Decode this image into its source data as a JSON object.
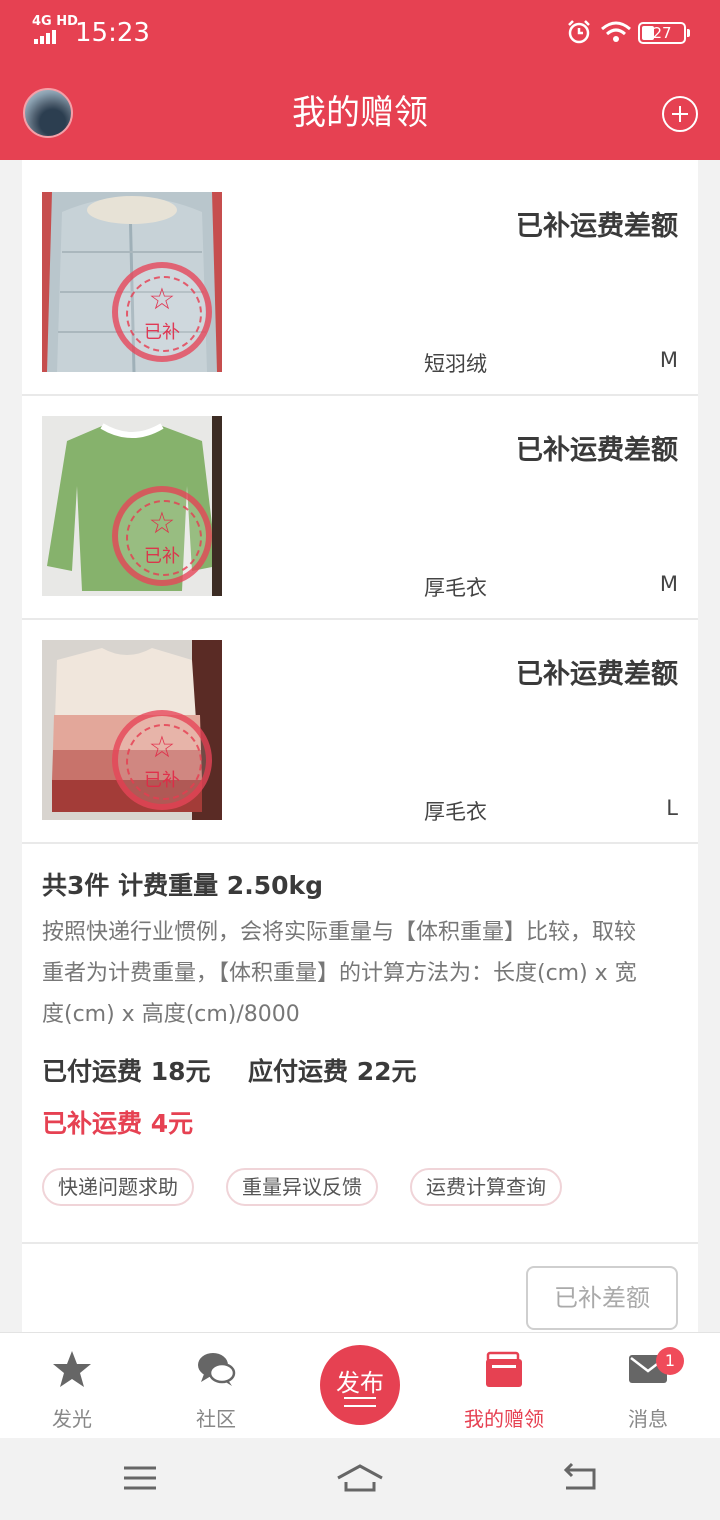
{
  "status_bar": {
    "network": "4G HD",
    "time": "15:23",
    "battery": "27"
  },
  "header": {
    "title": "我的赠领"
  },
  "items": [
    {
      "status": "已补运费差额",
      "name": "短羽绒",
      "size": "M",
      "stamp": "已补",
      "icon": "star-stamp-icon"
    },
    {
      "status": "已补运费差额",
      "name": "厚毛衣",
      "size": "M",
      "stamp": "已补",
      "icon": "star-stamp-icon"
    },
    {
      "status": "已补运费差额",
      "name": "厚毛衣",
      "size": "L",
      "stamp": "已补",
      "icon": "star-stamp-icon"
    }
  ],
  "summary": {
    "total": "共3件 计费重量 2.50kg",
    "note": "按照快递行业惯例，会将实际重量与【体积重量】比较，取较重者为计费重量，【体积重量】的计算方法为：长度(cm) x 宽度(cm) x 高度(cm)/8000",
    "paid": "已付运费 18元",
    "due": "应付运费 22元",
    "extra": "已补运费 4元",
    "chips": [
      "快递问题求助",
      "重量异议反馈",
      "运费计算查询"
    ]
  },
  "action_button": "已补差额",
  "tabs": [
    {
      "label": "发光",
      "icon": "star-icon"
    },
    {
      "label": "社区",
      "icon": "chat-bubbles-icon"
    },
    {
      "label": "发布",
      "icon": "publish-icon"
    },
    {
      "label": "我的赠领",
      "icon": "wallet-icon"
    },
    {
      "label": "消息",
      "icon": "mail-icon",
      "badge": "1"
    }
  ],
  "colors": {
    "brand": "#e64152",
    "text_dark": "#3a3a3a",
    "text_muted": "#777777"
  }
}
